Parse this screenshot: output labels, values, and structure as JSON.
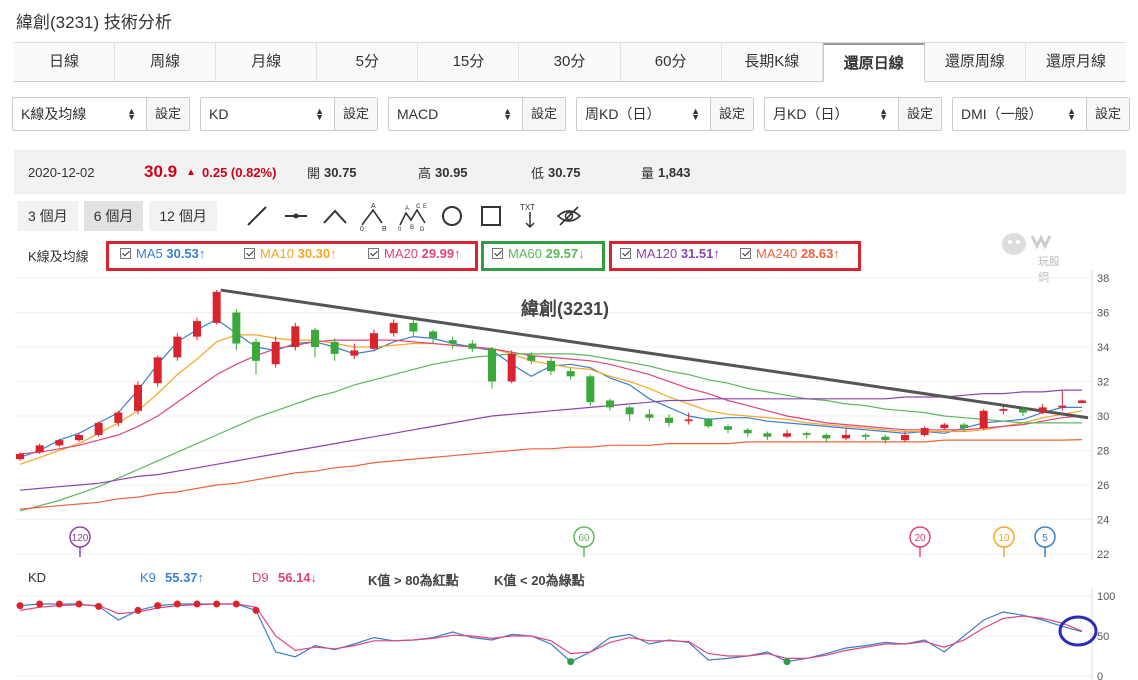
{
  "page_title": "緯創(3231) 技術分析",
  "tabs": [
    "日線",
    "周線",
    "月線",
    "5分",
    "15分",
    "30分",
    "60分",
    "長期K線",
    "還原日線",
    "還原周線",
    "還原月線"
  ],
  "active_tab": "還原日線",
  "indicator_selects": [
    {
      "value": "K線及均線",
      "button": "設定"
    },
    {
      "value": "KD",
      "button": "設定"
    },
    {
      "value": "MACD",
      "button": "設定"
    },
    {
      "value": "周KD（日）",
      "button": "設定"
    },
    {
      "value": "月KD（日）",
      "button": "設定"
    },
    {
      "value": "DMI（一般）",
      "button": "設定"
    }
  ],
  "quote": {
    "date": "2020-12-02",
    "price": "30.9",
    "change": "0.25 (0.82%)",
    "open_label": "開",
    "open": "30.75",
    "high_label": "高",
    "high": "30.95",
    "low_label": "低",
    "low": "30.75",
    "volume_label": "量",
    "volume": "1,843"
  },
  "ranges": [
    "3 個月",
    "6 個月",
    "12 個月"
  ],
  "active_range": "6 個月",
  "tools": [
    "line-tool-icon",
    "segment-tool-icon",
    "angle-tool-icon",
    "abc-wave-icon",
    "abcde-wave-icon",
    "circle-tool-icon",
    "rect-tool-icon",
    "text-tool-icon",
    "hide-drawings-icon"
  ],
  "text_tool_label": "TXT",
  "watermark": "玩股網",
  "ma_legend": {
    "label": "K線及均線",
    "items": [
      {
        "name": "MA5",
        "value": "30.53↑",
        "color": "#3a7fd0"
      },
      {
        "name": "MA10",
        "value": "30.30↑",
        "color": "#f5a623"
      },
      {
        "name": "MA20",
        "value": "29.99↑",
        "color": "#e0457b"
      },
      {
        "name": "MA60",
        "value": "29.57↓",
        "color": "#5cb85c"
      },
      {
        "name": "MA120",
        "value": "31.51↑",
        "color": "#8e44ad"
      },
      {
        "name": "MA240",
        "value": "28.63↑",
        "color": "#f0643c"
      }
    ]
  },
  "kd_legend": {
    "label": "KD",
    "k_name": "K9",
    "k_value": "55.37↑",
    "d_name": "D9",
    "d_value": "56.14↓",
    "note1": "K值 > 80為紅點",
    "note2": "K值 < 20為綠點"
  },
  "chart_data": [
    {
      "type": "candlestick",
      "title": "緯創(3231)",
      "ylim": [
        22,
        38
      ],
      "yticks": [
        "38",
        "36",
        "34",
        "32",
        "30",
        "28",
        "26",
        "24",
        "22"
      ],
      "markers": [
        "120",
        "60",
        "20",
        "10",
        "5"
      ],
      "series": [
        {
          "name": "MA5",
          "values": [
            27.6,
            28.0,
            28.6,
            29.0,
            29.6,
            30.2,
            31.5,
            33.0,
            34.3,
            35.0,
            35.6,
            34.8,
            34.0,
            33.8,
            34.2,
            34.3,
            34.0,
            33.6,
            33.8,
            34.3,
            34.6,
            34.5,
            34.2,
            34.0,
            33.8,
            33.0,
            32.3,
            32.9,
            33.0,
            32.8,
            32.2,
            31.8,
            31.0,
            30.5,
            30.0,
            29.8,
            29.9,
            29.9,
            29.7,
            29.6,
            29.5,
            29.4,
            29.3,
            29.2,
            29.1,
            29.0,
            29.1,
            29.0,
            29.3,
            29.6,
            29.7,
            29.8,
            30.2,
            30.5,
            30.5
          ]
        },
        {
          "name": "MA10",
          "values": [
            27.2,
            27.6,
            28.0,
            28.4,
            29.0,
            29.6,
            30.3,
            31.3,
            32.4,
            33.3,
            34.3,
            34.7,
            34.7,
            34.5,
            34.4,
            34.4,
            34.2,
            34.0,
            34.0,
            34.1,
            34.2,
            34.2,
            34.1,
            34.0,
            33.9,
            33.6,
            33.2,
            33.0,
            32.8,
            32.7,
            32.3,
            32.0,
            31.6,
            31.1,
            30.7,
            30.3,
            30.1,
            30.0,
            29.9,
            29.8,
            29.6,
            29.5,
            29.4,
            29.3,
            29.2,
            29.1,
            29.1,
            29.1,
            29.1,
            29.2,
            29.4,
            29.6,
            29.9,
            30.1,
            30.3
          ]
        },
        {
          "name": "MA20",
          "values": [
            27.8,
            27.9,
            28.1,
            28.3,
            28.6,
            28.9,
            29.4,
            30.0,
            30.8,
            31.6,
            32.4,
            33.0,
            33.5,
            33.9,
            34.1,
            34.3,
            34.4,
            34.4,
            34.4,
            34.4,
            34.3,
            34.2,
            34.1,
            34.0,
            33.9,
            33.7,
            33.5,
            33.4,
            33.3,
            33.2,
            33.0,
            32.7,
            32.4,
            32.0,
            31.6,
            31.3,
            30.9,
            30.6,
            30.3,
            30.0,
            29.8,
            29.6,
            29.5,
            29.4,
            29.3,
            29.2,
            29.2,
            29.2,
            29.2,
            29.3,
            29.4,
            29.5,
            29.7,
            29.9,
            30.0
          ]
        },
        {
          "name": "MA60",
          "values": [
            24.5,
            24.8,
            25.1,
            25.5,
            25.9,
            26.4,
            26.9,
            27.4,
            27.9,
            28.4,
            28.9,
            29.4,
            29.9,
            30.3,
            30.7,
            31.1,
            31.4,
            31.8,
            32.1,
            32.4,
            32.7,
            33.0,
            33.2,
            33.4,
            33.5,
            33.6,
            33.6,
            33.6,
            33.6,
            33.5,
            33.3,
            33.1,
            32.9,
            32.6,
            32.4,
            32.1,
            31.9,
            31.6,
            31.4,
            31.2,
            31.0,
            30.9,
            30.7,
            30.6,
            30.4,
            30.3,
            30.2,
            30.0,
            29.9,
            29.8,
            29.7,
            29.6,
            29.6,
            29.6,
            29.6
          ]
        },
        {
          "name": "MA120",
          "values": [
            25.7,
            25.8,
            25.9,
            26.0,
            26.1,
            26.3,
            26.5,
            26.6,
            26.8,
            27.0,
            27.2,
            27.4,
            27.6,
            27.8,
            28.0,
            28.2,
            28.4,
            28.6,
            28.8,
            29.0,
            29.2,
            29.4,
            29.6,
            29.8,
            30.0,
            30.1,
            30.2,
            30.3,
            30.4,
            30.5,
            30.6,
            30.7,
            30.8,
            30.9,
            30.9,
            31.0,
            31.0,
            31.0,
            31.0,
            31.0,
            31.0,
            31.0,
            31.0,
            31.0,
            31.0,
            31.1,
            31.1,
            31.1,
            31.2,
            31.3,
            31.3,
            31.4,
            31.4,
            31.5,
            31.5
          ]
        },
        {
          "name": "MA240",
          "values": [
            24.6,
            24.7,
            24.8,
            24.9,
            25.0,
            25.2,
            25.3,
            25.5,
            25.6,
            25.8,
            26.0,
            26.1,
            26.3,
            26.5,
            26.7,
            26.8,
            27.0,
            27.1,
            27.3,
            27.4,
            27.5,
            27.6,
            27.7,
            27.8,
            27.9,
            28.0,
            28.1,
            28.1,
            28.2,
            28.2,
            28.3,
            28.3,
            28.3,
            28.4,
            28.4,
            28.4,
            28.4,
            28.5,
            28.5,
            28.5,
            28.5,
            28.5,
            28.5,
            28.5,
            28.5,
            28.5,
            28.5,
            28.6,
            28.6,
            28.6,
            28.6,
            28.6,
            28.6,
            28.6,
            28.63
          ]
        },
        {
          "name": "trendline",
          "values": [
            37.3,
            29.9
          ]
        }
      ],
      "candles": [
        [
          27.5,
          27.8,
          27.9,
          27.4
        ],
        [
          27.9,
          28.3,
          28.4,
          27.8
        ],
        [
          28.3,
          28.6,
          28.7,
          28.2
        ],
        [
          28.6,
          28.9,
          29.0,
          28.5
        ],
        [
          28.9,
          29.6,
          29.7,
          28.8
        ],
        [
          29.6,
          30.2,
          30.3,
          29.4
        ],
        [
          30.3,
          31.8,
          32.0,
          30.1
        ],
        [
          31.9,
          33.4,
          33.5,
          31.7
        ],
        [
          33.4,
          34.6,
          34.8,
          33.2
        ],
        [
          34.6,
          35.5,
          35.7,
          34.4
        ],
        [
          35.4,
          37.2,
          37.3,
          35.3
        ],
        [
          36.0,
          34.2,
          36.2,
          33.8
        ],
        [
          34.3,
          33.2,
          34.5,
          32.4
        ],
        [
          33.0,
          34.3,
          34.6,
          32.8
        ],
        [
          34.0,
          35.2,
          35.4,
          33.8
        ],
        [
          35.0,
          34.0,
          35.1,
          33.4
        ],
        [
          34.3,
          33.6,
          34.5,
          33.2
        ],
        [
          33.5,
          33.8,
          34.2,
          33.3
        ],
        [
          33.9,
          34.8,
          35.0,
          33.8
        ],
        [
          34.8,
          35.4,
          35.6,
          34.6
        ],
        [
          35.4,
          34.9,
          35.6,
          34.6
        ],
        [
          34.9,
          34.5,
          35.0,
          34.2
        ],
        [
          34.4,
          34.2,
          34.6,
          33.9
        ],
        [
          34.2,
          33.9,
          34.4,
          33.7
        ],
        [
          33.9,
          32.0,
          34.0,
          31.6
        ],
        [
          32.0,
          33.6,
          33.8,
          31.9
        ],
        [
          33.5,
          33.2,
          33.7,
          33.0
        ],
        [
          33.2,
          32.6,
          33.4,
          32.4
        ],
        [
          32.6,
          32.3,
          32.8,
          32.1
        ],
        [
          32.3,
          30.8,
          32.4,
          30.6
        ],
        [
          30.9,
          30.5,
          31.0,
          30.3
        ],
        [
          30.5,
          30.1,
          30.6,
          29.7
        ],
        [
          30.1,
          29.9,
          30.4,
          29.7
        ],
        [
          29.9,
          29.6,
          30.1,
          29.4
        ],
        [
          29.7,
          29.8,
          30.2,
          29.5
        ],
        [
          29.8,
          29.4,
          29.9,
          29.3
        ],
        [
          29.4,
          29.2,
          29.5,
          29.0
        ],
        [
          29.2,
          29.0,
          29.3,
          28.8
        ],
        [
          29.0,
          28.8,
          29.1,
          28.6
        ],
        [
          28.8,
          29.0,
          29.2,
          28.7
        ],
        [
          29.0,
          28.9,
          29.1,
          28.7
        ],
        [
          28.9,
          28.7,
          29.0,
          28.5
        ],
        [
          28.7,
          28.9,
          29.3,
          28.6
        ],
        [
          28.9,
          28.8,
          29.0,
          28.6
        ],
        [
          28.8,
          28.6,
          28.9,
          28.4
        ],
        [
          28.6,
          28.9,
          29.1,
          28.5
        ],
        [
          28.9,
          29.3,
          29.4,
          28.8
        ],
        [
          29.3,
          29.5,
          29.6,
          29.2
        ],
        [
          29.5,
          29.3,
          29.6,
          29.1
        ],
        [
          29.3,
          30.3,
          30.4,
          29.2
        ],
        [
          30.3,
          30.4,
          30.6,
          30.1
        ],
        [
          30.4,
          30.2,
          30.5,
          30.0
        ],
        [
          30.2,
          30.5,
          30.7,
          30.1
        ],
        [
          30.5,
          30.6,
          31.5,
          30.3
        ],
        [
          30.75,
          30.9,
          30.95,
          30.75
        ]
      ]
    },
    {
      "type": "line",
      "title": "KD",
      "ylim": [
        0,
        100
      ],
      "yticks": [
        "100",
        "50",
        "0"
      ],
      "series": [
        {
          "name": "K9",
          "values": [
            88,
            90,
            90,
            90,
            87,
            70,
            82,
            88,
            90,
            90,
            90,
            90,
            82,
            30,
            24,
            38,
            33,
            40,
            48,
            44,
            45,
            48,
            55,
            48,
            45,
            52,
            50,
            40,
            18,
            30,
            48,
            52,
            40,
            45,
            42,
            20,
            22,
            25,
            30,
            18,
            22,
            28,
            35,
            38,
            42,
            40,
            45,
            30,
            50,
            70,
            80,
            76,
            70,
            62,
            55.37
          ]
        },
        {
          "name": "D9",
          "values": [
            82,
            86,
            88,
            89,
            88,
            78,
            80,
            85,
            88,
            89,
            90,
            90,
            86,
            50,
            32,
            36,
            34,
            38,
            44,
            44,
            45,
            47,
            51,
            50,
            47,
            50,
            50,
            44,
            28,
            30,
            42,
            48,
            44,
            44,
            43,
            28,
            25,
            25,
            28,
            22,
            22,
            26,
            32,
            36,
            40,
            40,
            43,
            36,
            45,
            60,
            72,
            75,
            72,
            66,
            56.14
          ]
        }
      ]
    }
  ]
}
